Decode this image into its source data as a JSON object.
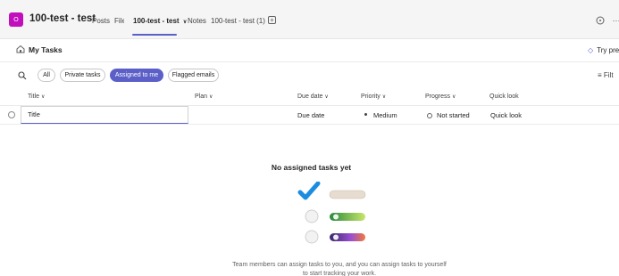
{
  "team": {
    "avatar_letter": "O",
    "title": "100-test - test"
  },
  "tabs": [
    {
      "label": "Posts"
    },
    {
      "label": "Files"
    },
    {
      "label": "100-test - test"
    },
    {
      "label": "Notes"
    },
    {
      "label": "100-test - test (1)"
    }
  ],
  "add_tab_symbol": "+",
  "page": {
    "title": "My Tasks",
    "try_premium": "Try pre"
  },
  "filters": [
    "All",
    "Private tasks",
    "Assigned to me",
    "Flagged emails"
  ],
  "filter_button": "Filt",
  "columns": [
    "Title",
    "Plan",
    "Due date",
    "Priority",
    "Progress",
    "Quick look"
  ],
  "new_row": {
    "title_placeholder": "Title",
    "due_date": "Due date",
    "priority": "Medium",
    "progress": "Not started",
    "quick_look": "Quick look"
  },
  "empty_state": {
    "title": "No assigned tasks yet",
    "description": "Team members can assign tasks to you, and you can assign tasks to yourself to start tracking your work."
  },
  "colors": {
    "accent": "#5b5fc7",
    "team_avatar": "#c20fbd"
  },
  "icons": [
    "home-icon",
    "search-icon",
    "chevron-down-icon",
    "diamond-icon",
    "filter-icon",
    "chat-icon",
    "more-icon"
  ]
}
